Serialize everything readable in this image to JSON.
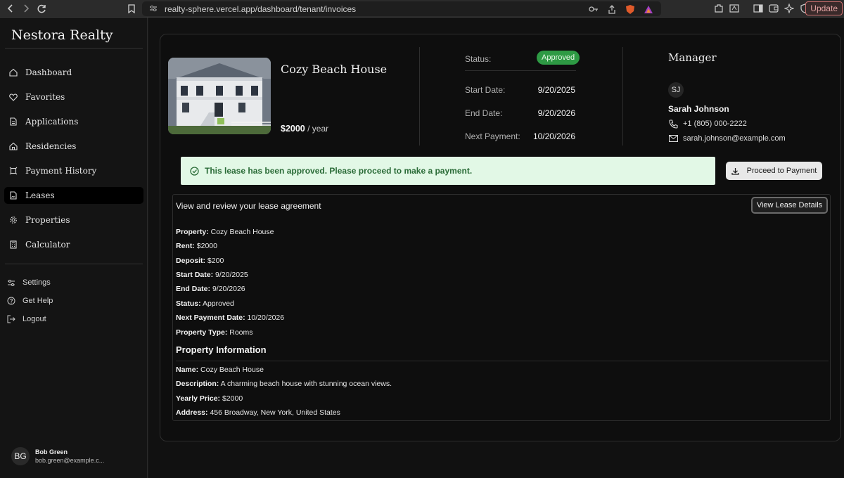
{
  "browser": {
    "url": "realty-sphere.vercel.app/dashboard/tenant/invoices",
    "update_label": "Update"
  },
  "sidebar": {
    "brand": "Nestora Realty",
    "items": [
      {
        "label": "Dashboard",
        "icon": "home-icon"
      },
      {
        "label": "Favorites",
        "icon": "heart-icon"
      },
      {
        "label": "Applications",
        "icon": "file-icon"
      },
      {
        "label": "Residencies",
        "icon": "home-icon"
      },
      {
        "label": "Payment History",
        "icon": "receipt-icon"
      },
      {
        "label": "Leases",
        "icon": "file-sign-icon",
        "active": true
      },
      {
        "label": "Properties",
        "icon": "gear-icon"
      },
      {
        "label": "Calculator",
        "icon": "calculator-icon"
      }
    ],
    "utilities": [
      {
        "label": "Settings",
        "icon": "sliders-icon"
      },
      {
        "label": "Get Help",
        "icon": "help-icon"
      },
      {
        "label": "Logout",
        "icon": "logout-icon"
      }
    ],
    "user": {
      "initials": "BG",
      "name": "Bob Green",
      "email": "bob.green@example.c..."
    }
  },
  "property": {
    "title": "Cozy Beach House",
    "price": "$2000",
    "price_unit": "/ year"
  },
  "lease_status": {
    "status_label": "Status:",
    "status_value": "Approved",
    "start_label": "Start Date:",
    "start_value": "9/20/2025",
    "end_label": "End Date:",
    "end_value": "9/20/2026",
    "next_label": "Next Payment:",
    "next_value": "10/20/2026"
  },
  "manager": {
    "title": "Manager",
    "initials": "SJ",
    "name": "Sarah Johnson",
    "phone": "+1 (805) 000-2222",
    "email": "sarah.johnson@example.com"
  },
  "alert": {
    "message": "This lease has been approved. Please proceed to make a payment."
  },
  "pay_button_label": "Proceed to Payment",
  "lease_agreement": {
    "heading": "View and review your lease agreement",
    "view_button_label": "View Lease Details",
    "fields": [
      {
        "key": "Property:",
        "value": "Cozy Beach House"
      },
      {
        "key": "Rent:",
        "value": "$2000"
      },
      {
        "key": "Deposit:",
        "value": "$200"
      },
      {
        "key": "Start Date:",
        "value": "9/20/2025"
      },
      {
        "key": "End Date:",
        "value": "9/20/2026"
      },
      {
        "key": "Status:",
        "value": "Approved"
      },
      {
        "key": "Next Payment Date:",
        "value": "10/20/2026"
      },
      {
        "key": "Property Type:",
        "value": "Rooms"
      }
    ],
    "info_title": "Property Information",
    "info_fields": [
      {
        "key": "Name:",
        "value": "Cozy Beach House"
      },
      {
        "key": "Description:",
        "value": "A charming beach house with stunning ocean views."
      },
      {
        "key": "Yearly Price:",
        "value": "$2000"
      },
      {
        "key": "Address:",
        "value": "456 Broadway, New York, United States"
      }
    ]
  },
  "colors": {
    "status_green": "#2e9a44",
    "alert_bg": "#e2f8e6",
    "alert_text": "#2a6b37"
  }
}
